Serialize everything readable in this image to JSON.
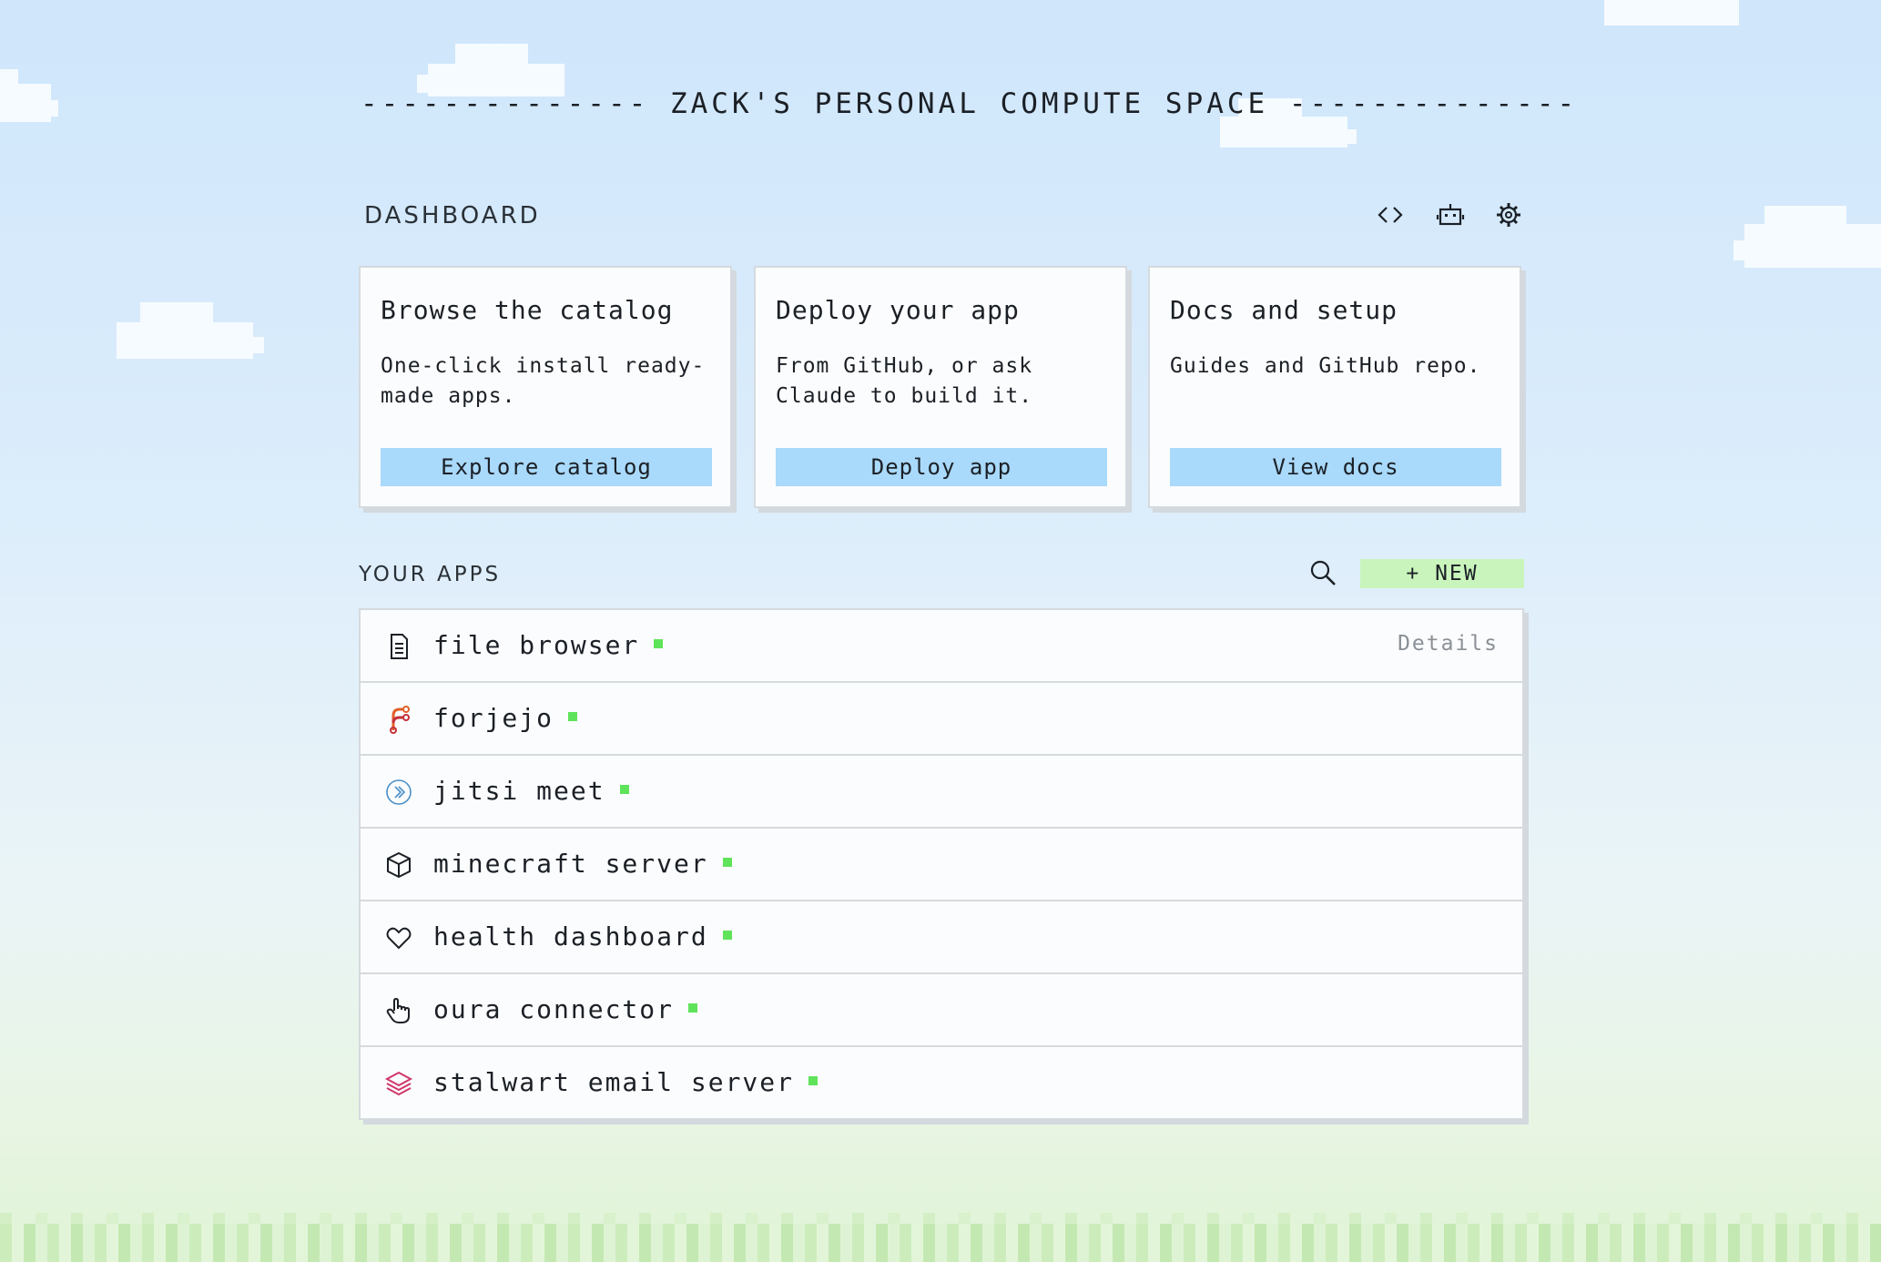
{
  "header": {
    "title": "-------------- ZACK'S PERSONAL COMPUTE SPACE --------------"
  },
  "dashboard": {
    "label": "DASHBOARD",
    "icons": [
      "code-icon",
      "robot-icon",
      "gear-icon"
    ],
    "cards": [
      {
        "title": "Browse the catalog",
        "desc": "One-click install ready-made apps.",
        "button": "Explore catalog"
      },
      {
        "title": "Deploy your app",
        "desc": "From GitHub, or ask Claude to build it.",
        "button": "Deploy app"
      },
      {
        "title": "Docs and setup",
        "desc": "Guides and GitHub repo.",
        "button": "View docs"
      }
    ]
  },
  "apps": {
    "label": "YOUR APPS",
    "new_label": "+ NEW",
    "details_label": "Details",
    "items": [
      {
        "name": "file browser",
        "icon": "document-icon",
        "status": "running"
      },
      {
        "name": "forjejo",
        "icon": "forgejo-icon",
        "status": "running"
      },
      {
        "name": "jitsi meet",
        "icon": "jitsi-icon",
        "status": "running"
      },
      {
        "name": "minecraft server",
        "icon": "cube-icon",
        "status": "running"
      },
      {
        "name": "health dashboard",
        "icon": "heart-icon",
        "status": "running"
      },
      {
        "name": "oura connector",
        "icon": "pointer-hand-icon",
        "status": "running"
      },
      {
        "name": "stalwart email server",
        "icon": "stack-icon",
        "status": "running"
      }
    ]
  },
  "colors": {
    "accent_button": "#a9d9fb",
    "new_button": "#c9f5bc",
    "status_running": "#5fe35a"
  }
}
